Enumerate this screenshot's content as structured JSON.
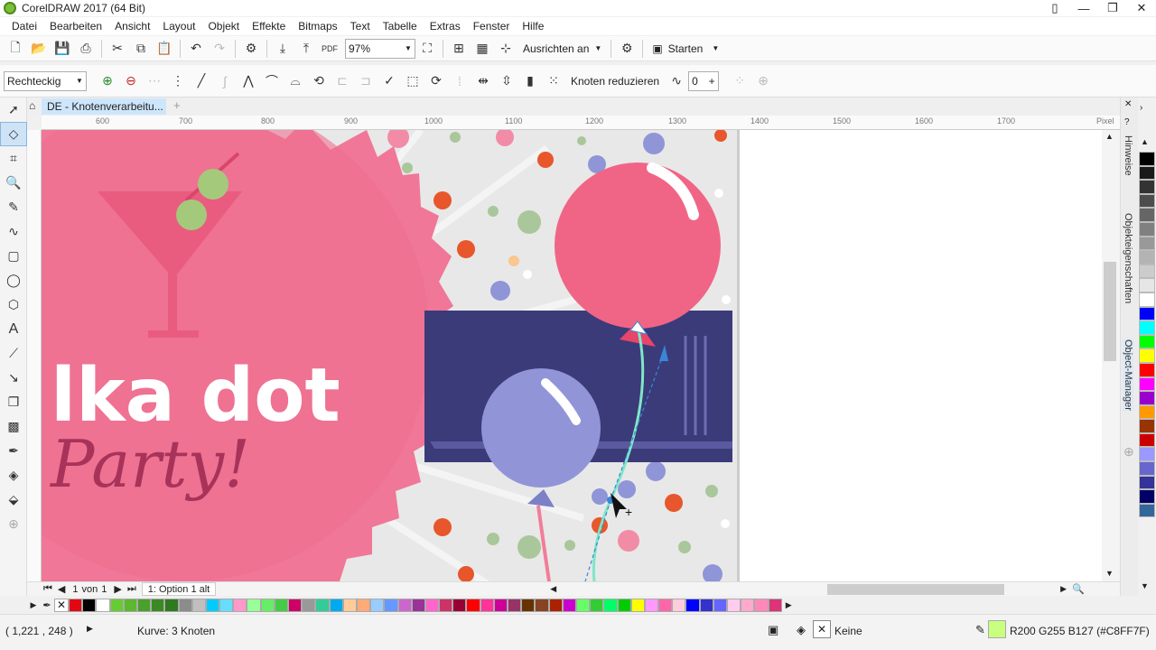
{
  "window": {
    "title": "CorelDRAW 2017 (64 Bit)",
    "minimize": "—",
    "maximize": "❐",
    "close": "✕"
  },
  "menu": [
    "Datei",
    "Bearbeiten",
    "Ansicht",
    "Layout",
    "Objekt",
    "Effekte",
    "Bitmaps",
    "Text",
    "Tabelle",
    "Extras",
    "Fenster",
    "Hilfe"
  ],
  "toolbar1": {
    "zoom": "97%",
    "snap_label": "Ausrichten an",
    "launch_label": "Starten"
  },
  "toolbar2": {
    "node_type": "Rechteckig",
    "reduce_label": "Knoten reduzieren",
    "smoothness": "0"
  },
  "document": {
    "tab_label": "DE - Knotenverarbeitu...",
    "ruler_unit": "Pixel",
    "ruler_marks": [
      "600",
      "700",
      "800",
      "900",
      "1000",
      "1100",
      "1200",
      "1300",
      "1400",
      "1500",
      "1600",
      "1700"
    ]
  },
  "artwork": {
    "headline": "lka dot",
    "subline": "Party!"
  },
  "pages": {
    "current": "1",
    "of_label": "von",
    "total": "1",
    "tab": "1: Option 1 alt"
  },
  "dockers": {
    "hints": "Hinweise",
    "properties": "Objekteigenschaften",
    "manager": "Object-Manager"
  },
  "status": {
    "coords": "( 1,221 , 248 )",
    "selection": "Kurve: 3 Knoten",
    "fill": "Keine",
    "outline": "R200 G255 B127 (#C8FF7F)"
  },
  "colors": {
    "vertical_palette": [
      "#000000",
      "#1a1a1a",
      "#333333",
      "#4d4d4d",
      "#666666",
      "#808080",
      "#999999",
      "#b3b3b3",
      "#cccccc",
      "#e6e6e6",
      "#ffffff",
      "#0000ff",
      "#00ffff",
      "#00ff00",
      "#ffff00",
      "#ff0000",
      "#ff00ff",
      "#9900cc",
      "#ff9900",
      "#993300",
      "#cc0000",
      "#9999ff",
      "#6666cc",
      "#333399",
      "#000066",
      "#336699"
    ],
    "horizontal_palette": [
      "#e30613",
      "#000000",
      "#ffffff",
      "#66cc33",
      "#5cb82e",
      "#4aa02a",
      "#3a8a24",
      "#2f7a1f",
      "#8c8c8c",
      "#bfbfbf",
      "#00ccff",
      "#66ddff",
      "#ff99cc",
      "#99ff99",
      "#66ee66",
      "#44cc44",
      "#cc0066",
      "#999999",
      "#33cc99",
      "#00aaee",
      "#ffcc99",
      "#ffaa77",
      "#99ccff",
      "#6699ff",
      "#cc66cc",
      "#993399",
      "#ff66cc",
      "#cc3366",
      "#990033",
      "#ff0000",
      "#ff3399",
      "#cc0099",
      "#993366",
      "#663300",
      "#884422",
      "#aa2200",
      "#cc00cc",
      "#66ff66",
      "#33cc33",
      "#00ff66",
      "#00cc00",
      "#ffff00",
      "#ff99ff",
      "#ff66aa",
      "#ffccdd",
      "#0000ff",
      "#3333cc",
      "#6666ff",
      "#ffccee",
      "#ffaacc",
      "#ff88bb",
      "#dd3377"
    ]
  }
}
